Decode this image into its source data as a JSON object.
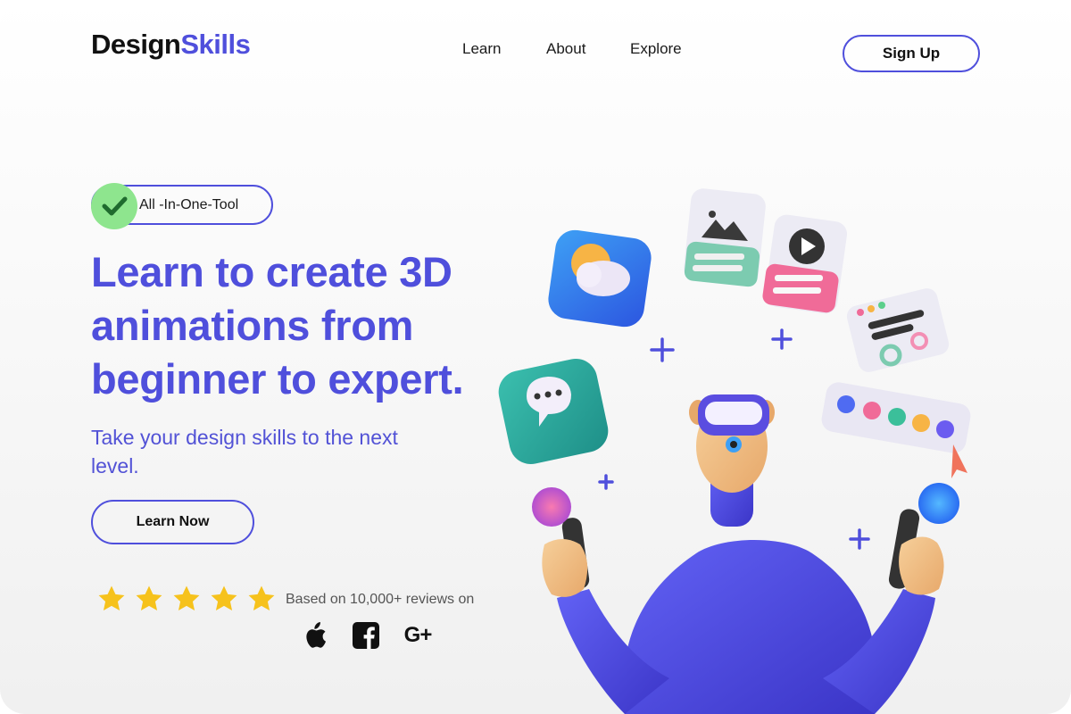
{
  "brand": {
    "part1": "Design",
    "part2": "Skills",
    "accent_color": "#4f4fdc"
  },
  "nav": {
    "items": [
      {
        "label": "Learn"
      },
      {
        "label": "About"
      },
      {
        "label": "Explore"
      }
    ]
  },
  "header": {
    "signup_label": "Sign Up"
  },
  "hero": {
    "badge_label": "All -In-One-Tool",
    "headline": "Learn to create 3D animations from beginner to expert.",
    "subheadline": "Take your design skills to the next level.",
    "cta_label": "Learn Now",
    "rating": {
      "stars": 5,
      "max_stars": 5,
      "text": "Based on 10,000+ reviews on"
    },
    "platforms": [
      {
        "icon": "apple-icon"
      },
      {
        "icon": "facebook-icon"
      },
      {
        "icon": "google-plus-icon",
        "label": "G+"
      }
    ]
  },
  "colors": {
    "primary": "#4f4fdc",
    "check_bg": "#8ee58e",
    "star": "#f6c21c"
  }
}
